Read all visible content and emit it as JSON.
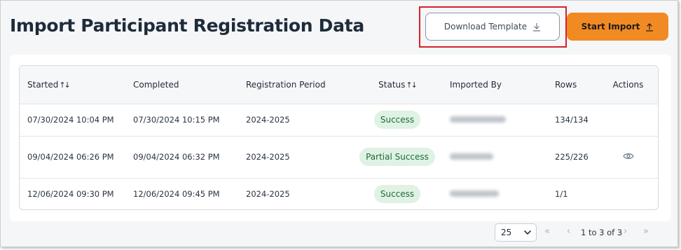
{
  "header": {
    "title": "Import Participant Registration Data",
    "download_template_label": "Download Template",
    "start_import_label": "Start Import"
  },
  "colors": {
    "primary": "#f28a24",
    "success_badge_bg": "#dff2e4",
    "success_badge_text": "#1d6b38",
    "highlight": "#d8202a"
  },
  "table": {
    "columns": [
      "Started",
      "Completed",
      "Registration Period",
      "Status",
      "Imported By",
      "Rows",
      "Actions"
    ],
    "sortable_icon": "↑↓",
    "rows": [
      {
        "started": "07/30/2024 10:04 PM",
        "completed": "07/30/2024 10:15 PM",
        "period": "2024-2025",
        "status": "Success",
        "rows": "134/134",
        "has_action": false
      },
      {
        "started": "09/04/2024 06:26 PM",
        "completed": "09/04/2024 06:32 PM",
        "period": "2024-2025",
        "status": "Partial Success",
        "rows": "225/226",
        "has_action": true,
        "action_icon": "eye-icon"
      },
      {
        "started": "12/06/2024 09:30 PM",
        "completed": "12/06/2024 09:45 PM",
        "period": "2024-2025",
        "status": "Success",
        "rows": "1/1",
        "has_action": false
      }
    ]
  },
  "pagination": {
    "page_size": "25",
    "info": "1 to 3 of 3"
  }
}
